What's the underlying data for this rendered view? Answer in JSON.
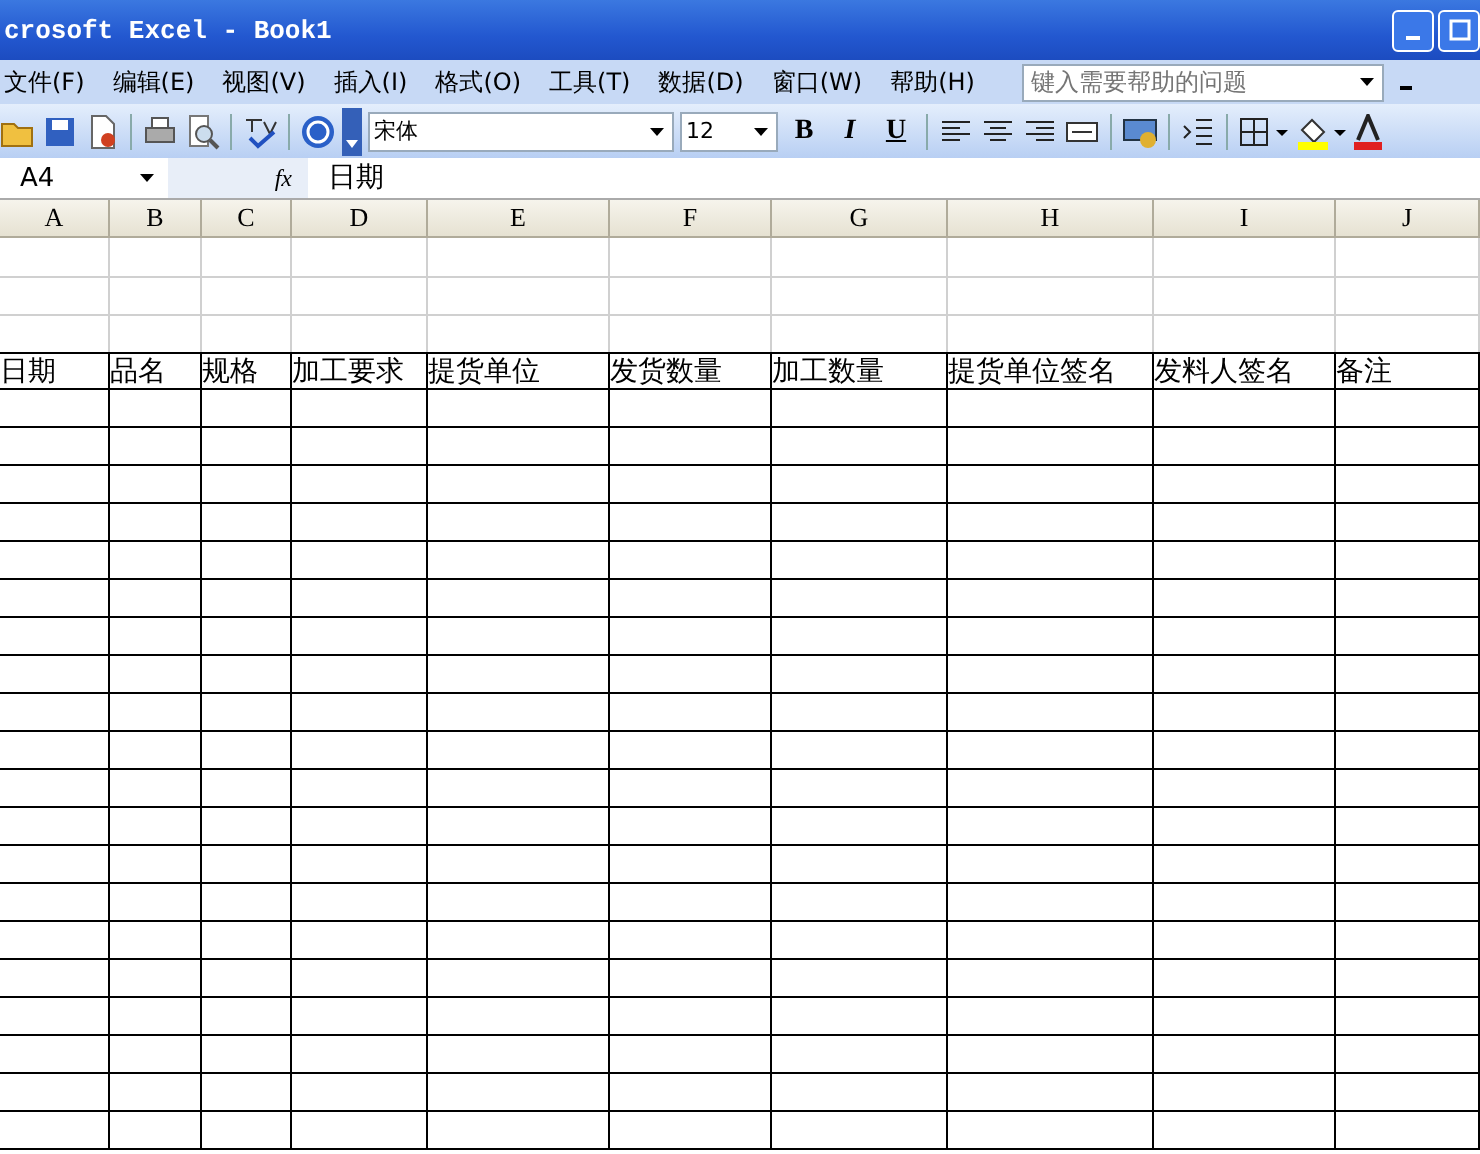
{
  "window": {
    "title": "crosoft Excel - Book1"
  },
  "menu": [
    "文件(F)",
    "编辑(E)",
    "视图(V)",
    "插入(I)",
    "格式(O)",
    "工具(T)",
    "数据(D)",
    "窗口(W)",
    "帮助(H)"
  ],
  "help_box": {
    "placeholder": "键入需要帮助的问题"
  },
  "toolbar": {
    "font": "宋体",
    "size": "12",
    "bold": "B",
    "italic": "I",
    "underline": "U"
  },
  "formula_bar": {
    "name_box": "A4",
    "fx": "fx",
    "value": "日期"
  },
  "sheet": {
    "columns": [
      "A",
      "B",
      "C",
      "D",
      "E",
      "F",
      "G",
      "H",
      "I",
      "J"
    ],
    "header_row": [
      "日期",
      "品名",
      "规格",
      "加工要求",
      "提货单位",
      "发货数量",
      "加工数量",
      "提货单位签名",
      "发料人签名",
      "备注"
    ]
  }
}
